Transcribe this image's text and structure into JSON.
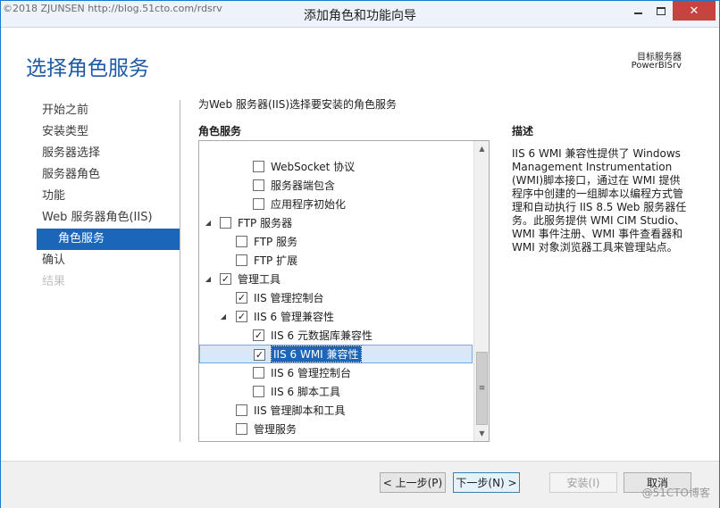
{
  "window": {
    "watermark": "©2018 ZJUNSEN http://blog.51cto.com/rdsrv",
    "title": "添加角色和功能向导",
    "close_glyph": "✕"
  },
  "header": {
    "page_title": "选择角色服务",
    "target_label": "目标服务器",
    "target_value": "PowerBISrv"
  },
  "nav": {
    "items": [
      {
        "label": "开始之前",
        "state": "normal"
      },
      {
        "label": "安装类型",
        "state": "normal"
      },
      {
        "label": "服务器选择",
        "state": "normal"
      },
      {
        "label": "服务器角色",
        "state": "normal"
      },
      {
        "label": "功能",
        "state": "normal"
      },
      {
        "label": "Web 服务器角色(IIS)",
        "state": "normal"
      },
      {
        "label": "角色服务",
        "state": "selected"
      },
      {
        "label": "确认",
        "state": "normal"
      },
      {
        "label": "结果",
        "state": "disabled"
      }
    ]
  },
  "main": {
    "instruction": "为Web 服务器(IIS)选择要安装的角色服务",
    "section_label": "角色服务",
    "tree": [
      {
        "label": "WebSocket 协议",
        "checked": false,
        "expander": ""
      },
      {
        "label": "服务器端包含",
        "checked": false,
        "expander": ""
      },
      {
        "label": "应用程序初始化",
        "checked": false,
        "expander": ""
      },
      {
        "label": "FTP 服务器",
        "checked": false,
        "expander": "◢"
      },
      {
        "label": "FTP 服务",
        "checked": false,
        "expander": ""
      },
      {
        "label": "FTP 扩展",
        "checked": false,
        "expander": ""
      },
      {
        "label": "管理工具",
        "checked": true,
        "expander": "◢"
      },
      {
        "label": "IIS 管理控制台",
        "checked": true,
        "expander": ""
      },
      {
        "label": "IIS 6 管理兼容性",
        "checked": true,
        "expander": "◢"
      },
      {
        "label": "IIS 6 元数据库兼容性",
        "checked": true,
        "expander": ""
      },
      {
        "label": "IIS 6 WMI 兼容性",
        "checked": true,
        "expander": "",
        "selected": true
      },
      {
        "label": "IIS 6 管理控制台",
        "checked": false,
        "expander": ""
      },
      {
        "label": "IIS 6 脚本工具",
        "checked": false,
        "expander": ""
      },
      {
        "label": "IIS 管理脚本和工具",
        "checked": false,
        "expander": ""
      },
      {
        "label": "管理服务",
        "checked": false,
        "expander": ""
      }
    ]
  },
  "description": {
    "label": "描述",
    "text": "IIS 6 WMI 兼容性提供了 Windows Management Instrumentation (WMI)脚本接口，通过在 WMI 提供程序中创建的一组脚本以编程方式管理和自动执行 IIS 8.5 Web 服务器任务。此服务提供 WMI CIM Studio、WMI 事件注册、WMI 事件查看器和 WMI 对象浏览器工具来管理站点。"
  },
  "footer": {
    "prev_label": "< 上一步(P)",
    "next_label": "下一步(N) >",
    "install_label": "安装(I)",
    "cancel_label": "取消",
    "watermark": "@51CTO博客"
  },
  "colors": {
    "accent": "#1b66b8",
    "title_blue": "#1e5aa5",
    "close_red": "#c7433e"
  }
}
